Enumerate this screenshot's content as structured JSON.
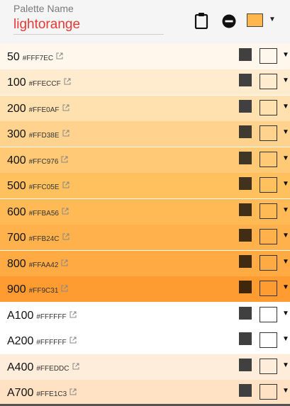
{
  "header": {
    "field_label": "Palette Name",
    "palette_name": "lightorange",
    "swatch_color": "#FFB74D"
  },
  "rows": [
    {
      "name": "50",
      "hex": "#FFF7EC",
      "bg": "#FFF7EC",
      "text_swatch": "#404040"
    },
    {
      "name": "100",
      "hex": "#FFECCF",
      "bg": "#FFECCF",
      "text_swatch": "#404040"
    },
    {
      "name": "200",
      "hex": "#FFE0AF",
      "bg": "#FFE0AF",
      "text_swatch": "#404040"
    },
    {
      "name": "300",
      "hex": "#FFD38E",
      "bg": "#FFD38E",
      "text_swatch": "#403b30"
    },
    {
      "name": "400",
      "hex": "#FFC976",
      "bg": "#FFC976",
      "text_swatch": "#403625"
    },
    {
      "name": "500",
      "hex": "#FFC05E",
      "bg": "#FFC05E",
      "text_swatch": "#40321c"
    },
    {
      "name": "600",
      "hex": "#FFBA56",
      "bg": "#FFBA56",
      "text_swatch": "#402f18"
    },
    {
      "name": "700",
      "hex": "#FFB24C",
      "bg": "#FFB24C",
      "text_swatch": "#402d14"
    },
    {
      "name": "800",
      "hex": "#FFAA42",
      "bg": "#FFAA42",
      "text_swatch": "#402b10"
    },
    {
      "name": "900",
      "hex": "#FF9C31",
      "bg": "#FF9C31",
      "text_swatch": "#40270c"
    },
    {
      "name": "A100",
      "hex": "#FFFFFF",
      "bg": "#FFFFFF",
      "text_swatch": "#404040"
    },
    {
      "name": "A200",
      "hex": "#FFFFFF",
      "bg": "#FFFFFF",
      "text_swatch": "#404040"
    },
    {
      "name": "A400",
      "hex": "#FFEDDC",
      "bg": "#FFEDDC",
      "text_swatch": "#404040"
    },
    {
      "name": "A700",
      "hex": "#FFE1C3",
      "bg": "#FFE1C3",
      "text_swatch": "#404040"
    }
  ]
}
